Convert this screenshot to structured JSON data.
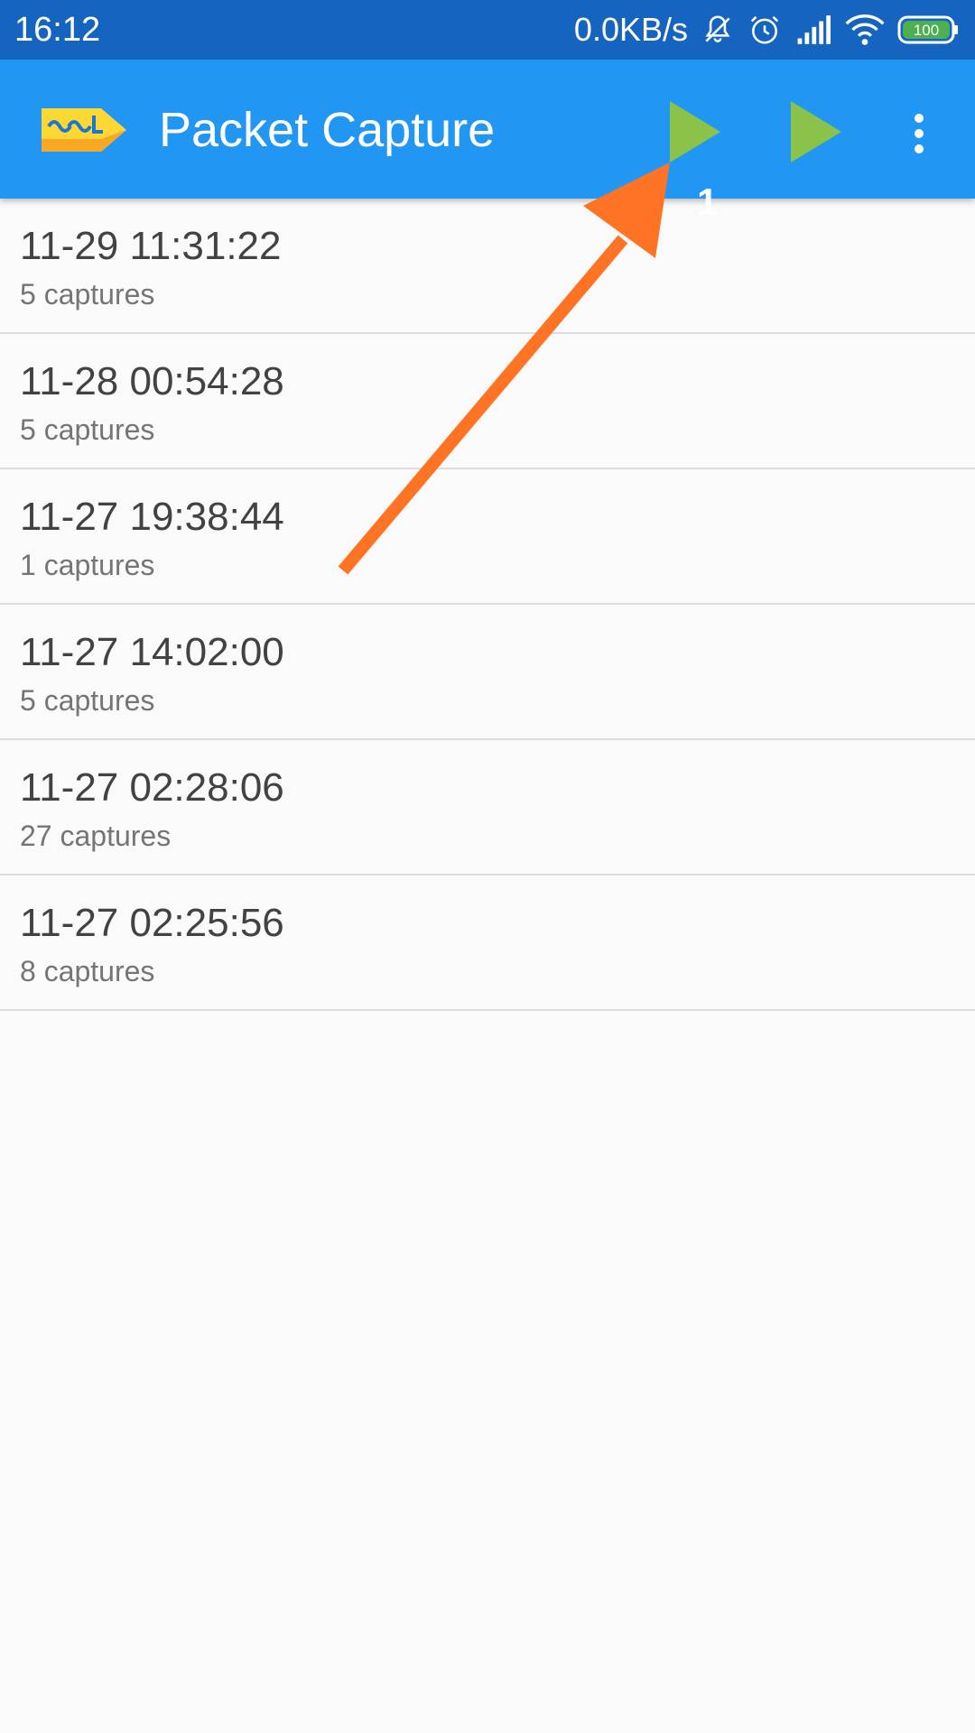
{
  "status_bar": {
    "time": "16:12",
    "net_speed": "0.0KB/s",
    "battery": "100",
    "icons": [
      "mute-notifications-icon",
      "alarm-icon",
      "signal-icon",
      "wifi-icon",
      "battery-icon"
    ]
  },
  "toolbar": {
    "title": "Packet Capture",
    "logo_icon": "ssl-logo-icon",
    "actions": [
      {
        "name": "play-button-1",
        "icon": "play-icon",
        "badge": "1"
      },
      {
        "name": "play-button-2",
        "icon": "play-icon"
      },
      {
        "name": "overflow-menu-button",
        "icon": "more-vert-icon"
      }
    ],
    "colors": {
      "appbar": "#2196f3",
      "statusbar": "#1565c0",
      "play": "#8bc34a",
      "logo": "#fdd835"
    }
  },
  "sessions": [
    {
      "time": "11-29 11:31:22",
      "count": "5 captures"
    },
    {
      "time": "11-28 00:54:28",
      "count": "5 captures"
    },
    {
      "time": "11-27 19:38:44",
      "count": "1 captures"
    },
    {
      "time": "11-27 14:02:00",
      "count": "5 captures"
    },
    {
      "time": "11-27 02:28:06",
      "count": "27 captures"
    },
    {
      "time": "11-27 02:25:56",
      "count": "8 captures"
    }
  ],
  "annotation": {
    "color": "#ff7424"
  }
}
